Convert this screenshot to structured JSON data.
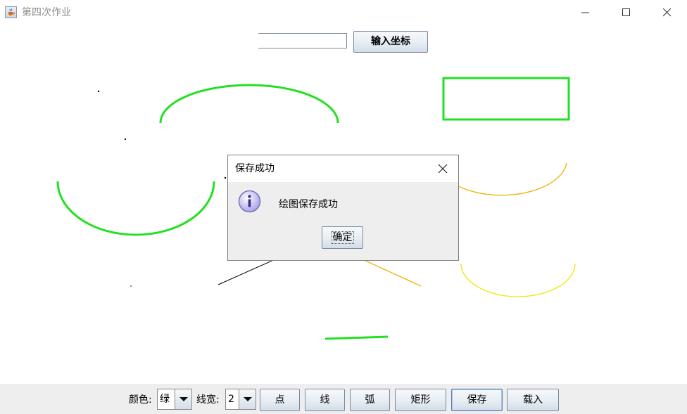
{
  "window": {
    "title": "第四次作业",
    "icon": "java-cup-icon"
  },
  "window_controls": [
    "minimize-icon",
    "maximize-icon",
    "close-icon"
  ],
  "top_bar": {
    "coord_input_value": "",
    "coord_button_label": "输入坐标"
  },
  "colors": {
    "green": "#22e022",
    "orange": "#f0b000",
    "yellow": "#f2e600",
    "black": "#000000"
  },
  "dialog": {
    "title": "保存成功",
    "message": "绘图保存成功",
    "ok_label": "确定",
    "icon": "info-icon"
  },
  "toolbar": {
    "color_label": "颜色:",
    "color_value": "绿",
    "width_label": "线宽:",
    "width_value": "2",
    "point_label": "点",
    "line_label": "线",
    "arc_label": "弧",
    "rect_label": "矩形",
    "save_label": "保存",
    "load_label": "载入"
  }
}
